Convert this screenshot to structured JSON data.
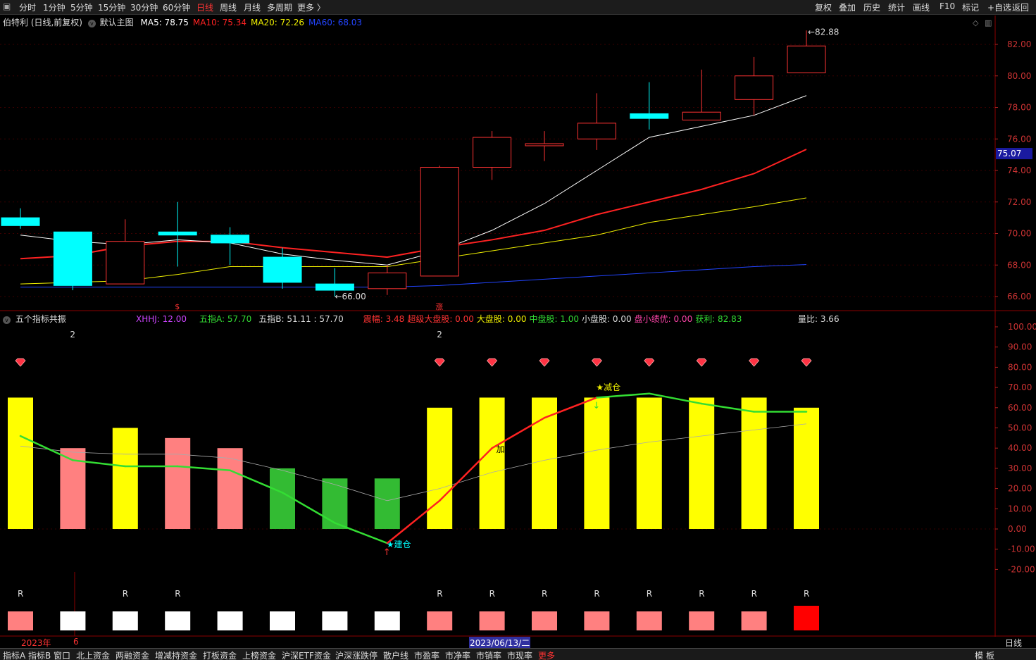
{
  "toolbar": {
    "periods": [
      "分时",
      "1分钟",
      "5分钟",
      "15分钟",
      "30分钟",
      "60分钟",
      "日线",
      "周线",
      "月线",
      "多周期",
      "更多 〉"
    ],
    "active_period": "日线",
    "right_actions": [
      "复权",
      "叠加",
      "历史",
      "统计",
      "画线",
      "F10",
      "标记",
      "+自选",
      "返回"
    ]
  },
  "main_chart": {
    "stock_label": "伯特利 (日线,前复权)",
    "main_chart_label": "默认主图",
    "ma": [
      {
        "label": "MA5: 78.75",
        "color": "#ffffff"
      },
      {
        "label": "MA10: 75.34",
        "color": "#ff2222"
      },
      {
        "label": "MA20: 72.26",
        "color": "#f0f000"
      },
      {
        "label": "MA60: 68.03",
        "color": "#2244ff"
      }
    ],
    "price_axis": [
      "82.00",
      "80.00",
      "78.00",
      "76.00",
      "74.00",
      "72.00",
      "70.00",
      "68.00",
      "66.00"
    ],
    "current_price_tag": "75.07",
    "high_label": "82.88",
    "low_label": "66.00",
    "markers": [
      {
        "text": "$",
        "color": "#ff3333"
      },
      {
        "text": "涨",
        "color": "#ff3333"
      }
    ],
    "colors": {
      "up": "#ff3333",
      "down": "#00ffff",
      "ma5": "#ffffff",
      "ma10": "#ff2222",
      "ma20": "#f0f000",
      "ma60": "#2244ff"
    }
  },
  "chart_data": {
    "type": "candlestick",
    "candles": [
      {
        "o": 71.0,
        "c": 70.5,
        "h": 71.6,
        "l": 70.3
      },
      {
        "o": 70.1,
        "c": 66.7,
        "h": 70.1,
        "l": 66.4
      },
      {
        "o": 66.8,
        "c": 69.5,
        "h": 70.9,
        "l": 66.8
      },
      {
        "o": 70.1,
        "c": 69.9,
        "h": 72.0,
        "l": 67.9
      },
      {
        "o": 69.9,
        "c": 69.4,
        "h": 70.4,
        "l": 68.0
      },
      {
        "o": 68.5,
        "c": 66.9,
        "h": 69.1,
        "l": 66.5
      },
      {
        "o": 66.8,
        "c": 66.4,
        "h": 67.8,
        "l": 66.0
      },
      {
        "o": 66.5,
        "c": 67.5,
        "h": 68.0,
        "l": 66.1
      },
      {
        "o": 67.3,
        "c": 74.2,
        "h": 74.3,
        "l": 67.3
      },
      {
        "o": 74.2,
        "c": 76.1,
        "h": 76.5,
        "l": 73.4
      },
      {
        "o": 75.7,
        "c": 75.7,
        "h": 76.5,
        "l": 74.6
      },
      {
        "o": 76.0,
        "c": 77.0,
        "h": 78.9,
        "l": 75.3
      },
      {
        "o": 77.6,
        "c": 77.3,
        "h": 79.6,
        "l": 76.6
      },
      {
        "o": 77.2,
        "c": 77.7,
        "h": 80.4,
        "l": 77.2
      },
      {
        "o": 78.5,
        "c": 80.0,
        "h": 81.2,
        "l": 77.5
      },
      {
        "o": 80.2,
        "c": 81.9,
        "h": 82.88,
        "l": 80.2
      }
    ],
    "ma5": [
      69.9,
      69.5,
      69.3,
      69.6,
      69.4,
      68.7,
      68.3,
      68.0,
      68.9,
      70.2,
      71.9,
      74.0,
      76.1,
      76.8,
      77.5,
      78.75
    ],
    "ma10": [
      68.4,
      68.6,
      69.2,
      69.5,
      69.5,
      69.1,
      68.8,
      68.5,
      69.1,
      69.6,
      70.2,
      71.2,
      72.0,
      72.8,
      73.8,
      75.34
    ],
    "ma20": [
      66.8,
      66.9,
      67.0,
      67.4,
      67.9,
      67.9,
      67.9,
      67.9,
      68.4,
      68.9,
      69.4,
      69.9,
      70.7,
      71.2,
      71.7,
      72.26
    ],
    "ma60": [
      66.6,
      66.6,
      66.6,
      66.6,
      66.6,
      66.6,
      66.6,
      66.6,
      66.7,
      66.9,
      67.1,
      67.3,
      67.5,
      67.7,
      67.9,
      68.03
    ],
    "ylim": [
      65.5,
      83.5
    ]
  },
  "indicator": {
    "name": "五个指标共振",
    "stats": [
      {
        "label": "XHHJ: 12.00",
        "color": "#cc44ff"
      },
      {
        "label": "五指A: 57.70",
        "color": "#33dd33"
      },
      {
        "label": "五指B: 51.11 : 57.70",
        "color": "#dddddd"
      },
      {
        "label": "震幅: 3.48",
        "color": "#ff3333"
      },
      {
        "label": "超级大盘股: 0.00",
        "color": "#ff3333"
      },
      {
        "label": "大盘股: 0.00",
        "color": "#f0f000"
      },
      {
        "label": "中盘股: 1.00",
        "color": "#33dd33"
      },
      {
        "label": "小盘股: 0.00",
        "color": "#dddddd"
      },
      {
        "label": "盘小绩优: 0.00",
        "color": "#ff44aa"
      },
      {
        "label": "获利: 82.83",
        "color": "#33dd33"
      }
    ],
    "volume_ratio": "量比: 3.66",
    "axis": [
      "100.00",
      "90.00",
      "80.00",
      "70.00",
      "60.00",
      "50.00",
      "40.00",
      "30.00",
      "20.00",
      "10.00",
      "0.00",
      "-10.00",
      "-20.00"
    ],
    "bars": [
      65,
      40,
      50,
      45,
      40,
      30,
      25,
      25,
      60,
      65,
      65,
      65,
      65,
      65,
      65,
      60
    ],
    "bar_colors": [
      "yellow",
      "pink",
      "yellow",
      "pink",
      "pink",
      "green",
      "green",
      "green",
      "yellow",
      "yellow",
      "yellow",
      "yellow",
      "yellow",
      "yellow",
      "yellow",
      "yellow"
    ],
    "line_a": [
      46,
      34,
      31,
      31,
      29,
      18,
      3,
      -7,
      14,
      40,
      55,
      65,
      67,
      62,
      58,
      58
    ],
    "line_b": [
      41,
      38,
      37,
      37,
      35,
      29,
      22,
      14,
      20,
      28,
      34,
      39,
      43,
      46,
      49,
      52
    ],
    "top_numbers": [
      {
        "index": 1,
        "text": "2"
      },
      {
        "index": 8,
        "text": "2"
      }
    ],
    "diamond_indices": [
      0,
      8,
      9,
      10,
      11,
      12,
      13,
      14,
      15
    ],
    "signals": [
      {
        "index": 7,
        "text": "★建仓",
        "color": "#00ffff"
      },
      {
        "index": 11,
        "text": "★减仓",
        "color": "#f0f000"
      },
      {
        "index": 9,
        "text": "加仓",
        "color": "#000000"
      }
    ],
    "r_indices": [
      0,
      2,
      3,
      8,
      9,
      10,
      11,
      12,
      13,
      14,
      15
    ],
    "r_label": "R",
    "box_colors": [
      "pink",
      "white",
      "white",
      "white",
      "white",
      "white",
      "white",
      "white",
      "pink",
      "pink",
      "pink",
      "pink",
      "pink",
      "pink",
      "pink",
      "red"
    ],
    "colors": {
      "yellow": "#ffff00",
      "pink": "#ff8080",
      "green": "#33bb33",
      "white": "#ffffff",
      "red": "#ff0000"
    }
  },
  "time_axis": {
    "year_label": "2023年",
    "month_label": "6",
    "cursor_date": "2023/06/13/二",
    "period_label": "日线"
  },
  "bottom_tabs": [
    "指标A",
    "指标B",
    "窗口",
    "北上资金",
    "两融资金",
    "增减持资金",
    "打板资金",
    "上榜资金",
    "沪深ETF资金",
    "沪深涨跌停",
    "散户线",
    "市盈率",
    "市净率",
    "市销率",
    "市现率",
    "更多"
  ],
  "bottom_right": [
    "模",
    "板"
  ]
}
